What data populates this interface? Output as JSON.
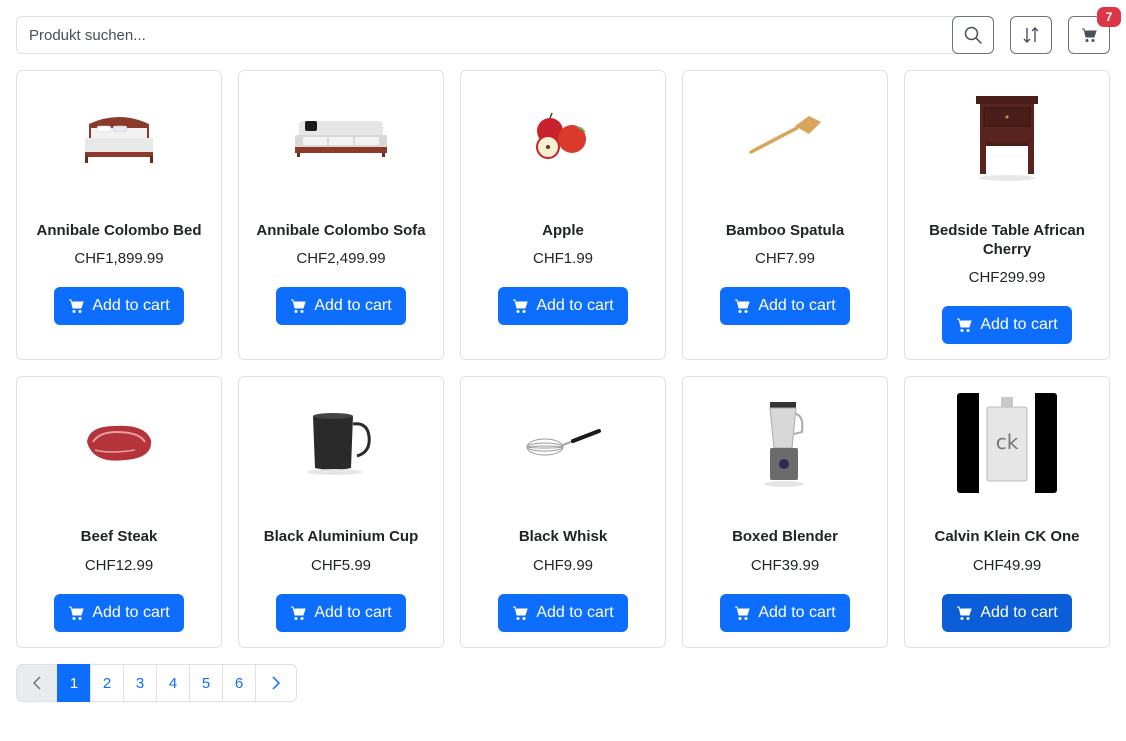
{
  "search": {
    "placeholder": "Produkt suchen..."
  },
  "toolbar": {
    "search_icon": "search-icon",
    "sort_icon": "sort-arrows-icon",
    "cart_icon": "cart-icon",
    "cart_count": "7"
  },
  "colors": {
    "primary": "#0d6efd",
    "primary_active": "#0b5ed7",
    "badge": "#dc3545",
    "border": "#dee2e6",
    "outline_button": "#6c757d"
  },
  "products": [
    {
      "name": "Annibale Colombo Bed",
      "price": "CHF1,899.99",
      "image": "bed-image",
      "button": "Add to cart"
    },
    {
      "name": "Annibale Colombo Sofa",
      "price": "CHF2,499.99",
      "image": "sofa-image",
      "button": "Add to cart"
    },
    {
      "name": "Apple",
      "price": "CHF1.99",
      "image": "apple-image",
      "button": "Add to cart"
    },
    {
      "name": "Bamboo Spatula",
      "price": "CHF7.99",
      "image": "spatula-image",
      "button": "Add to cart"
    },
    {
      "name": "Bedside Table African Cherry",
      "price": "CHF299.99",
      "image": "bedside-table-image",
      "button": "Add to cart"
    },
    {
      "name": "Beef Steak",
      "price": "CHF12.99",
      "image": "steak-image",
      "button": "Add to cart"
    },
    {
      "name": "Black Aluminium Cup",
      "price": "CHF5.99",
      "image": "cup-image",
      "button": "Add to cart"
    },
    {
      "name": "Black Whisk",
      "price": "CHF9.99",
      "image": "whisk-image",
      "button": "Add to cart"
    },
    {
      "name": "Boxed Blender",
      "price": "CHF39.99",
      "image": "blender-image",
      "button": "Add to cart"
    },
    {
      "name": "Calvin Klein CK One",
      "price": "CHF49.99",
      "image": "perfume-image",
      "button": "Add to cart"
    }
  ],
  "pagination": {
    "prev_icon": "chevron-left-icon",
    "next_icon": "chevron-right-icon",
    "pages": [
      "1",
      "2",
      "3",
      "4",
      "5",
      "6"
    ],
    "current": "1"
  }
}
